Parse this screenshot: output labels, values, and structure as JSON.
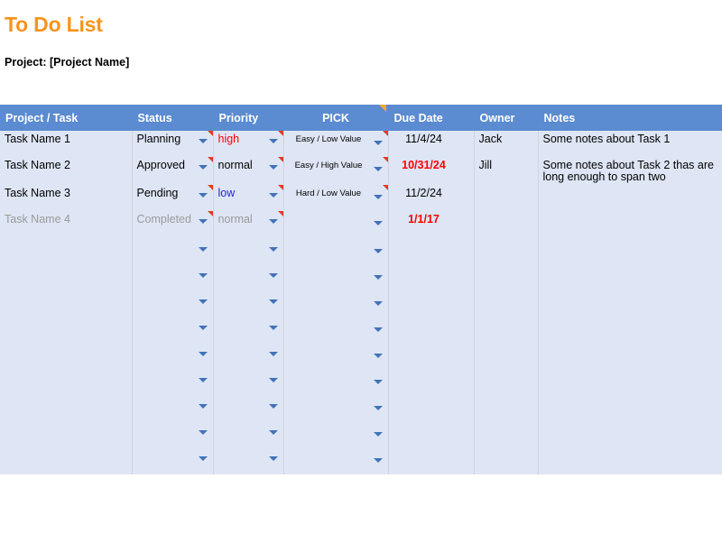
{
  "title": "To Do List",
  "project_line": "Project: [Project Name]",
  "colors": {
    "title": "#f7941e",
    "header_bg": "#5b8bd0",
    "cell_bg": "#dee6f5",
    "overdue": "#ff0000",
    "disabled": "#9a9a9a",
    "comment_marker": "#e23b26",
    "comment_marker_header": "#f7a733",
    "dropdown_arrow": "#4472b8"
  },
  "table": {
    "headers": [
      {
        "label": "Project / Task",
        "align": "left"
      },
      {
        "label": "Status",
        "align": "left"
      },
      {
        "label": "Priority",
        "align": "left"
      },
      {
        "label": "PICK",
        "align": "center",
        "comment_marker": "orange"
      },
      {
        "label": "Due Date",
        "align": "left"
      },
      {
        "label": "Owner",
        "align": "left"
      },
      {
        "label": "Notes",
        "align": "left"
      }
    ],
    "rows": [
      {
        "task": "Task Name 1",
        "status": "Planning",
        "priority": "high",
        "pick": "Easy / Low Value",
        "due_date": "11/4/24",
        "owner": "Jack",
        "notes": "Some notes about Task 1"
      },
      {
        "task": "Task Name 2",
        "status": "Approved",
        "priority": "normal",
        "pick": "Easy / High Value",
        "due_date": "10/31/24",
        "owner": "Jill",
        "notes": "Some notes about Task 2 thas are long enough to span two"
      },
      {
        "task": "Task Name 3",
        "status": "Pending",
        "priority": "low",
        "pick": "Hard / Low Value",
        "due_date": "11/2/24",
        "owner": "",
        "notes": ""
      },
      {
        "task": "Task Name 4",
        "status": "Completed",
        "priority": "normal",
        "pick": "",
        "due_date": "1/1/17",
        "owner": "",
        "notes": ""
      },
      {
        "task": "",
        "status": "",
        "priority": "",
        "pick": "",
        "due_date": "",
        "owner": "",
        "notes": ""
      },
      {
        "task": "",
        "status": "",
        "priority": "",
        "pick": "",
        "due_date": "",
        "owner": "",
        "notes": ""
      },
      {
        "task": "",
        "status": "",
        "priority": "",
        "pick": "",
        "due_date": "",
        "owner": "",
        "notes": ""
      },
      {
        "task": "",
        "status": "",
        "priority": "",
        "pick": "",
        "due_date": "",
        "owner": "",
        "notes": ""
      },
      {
        "task": "",
        "status": "",
        "priority": "",
        "pick": "",
        "due_date": "",
        "owner": "",
        "notes": ""
      },
      {
        "task": "",
        "status": "",
        "priority": "",
        "pick": "",
        "due_date": "",
        "owner": "",
        "notes": ""
      },
      {
        "task": "",
        "status": "",
        "priority": "",
        "pick": "",
        "due_date": "",
        "owner": "",
        "notes": ""
      },
      {
        "task": "",
        "status": "",
        "priority": "",
        "pick": "",
        "due_date": "",
        "owner": "",
        "notes": ""
      },
      {
        "task": "",
        "status": "",
        "priority": "",
        "pick": "",
        "due_date": "",
        "owner": "",
        "notes": ""
      }
    ]
  }
}
